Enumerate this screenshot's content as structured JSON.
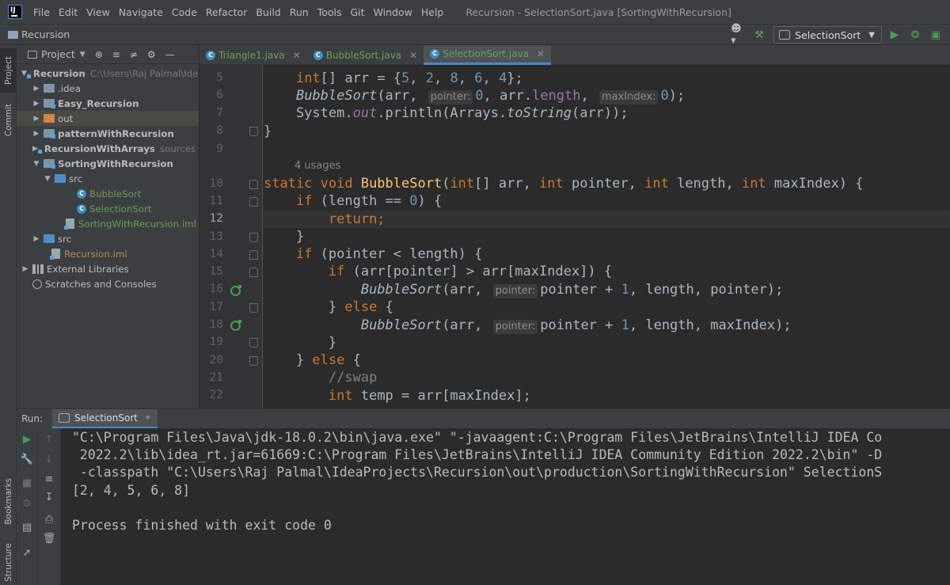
{
  "app": {
    "logo_text": "IJ",
    "window_title": "Recursion - SelectionSort.java [SortingWithRecursion]"
  },
  "menu": [
    "File",
    "Edit",
    "View",
    "Navigate",
    "Code",
    "Refactor",
    "Build",
    "Run",
    "Tools",
    "Git",
    "Window",
    "Help"
  ],
  "navbar": {
    "breadcrumb": "Recursion",
    "run_config": "SelectionSort"
  },
  "left_strip": {
    "project_tab": "Project",
    "commit_tab": "Commit",
    "bookmarks_tab": "Bookmarks",
    "structure_tab": "Structure"
  },
  "project_panel": {
    "title": "Project",
    "tree": [
      {
        "label": "Recursion",
        "hint": "C:\\Users\\Raj Palmal\\IdeaPr"
      },
      {
        "label": ".idea"
      },
      {
        "label": "Easy_Recursion"
      },
      {
        "label": "out"
      },
      {
        "label": "patternWithRecursion"
      },
      {
        "label": "RecursionWithArrays",
        "hint": "sources ro"
      },
      {
        "label": "SortingWithRecursion"
      },
      {
        "label": "src"
      },
      {
        "label": "BubbleSort"
      },
      {
        "label": "SelectionSort"
      },
      {
        "label": "SortingWithRecursion.iml"
      },
      {
        "label": "src"
      },
      {
        "label": "Recursion.iml"
      },
      {
        "label": "External Libraries"
      },
      {
        "label": "Scratches and Consoles"
      }
    ]
  },
  "tabs": [
    {
      "label": "Triangle1.java"
    },
    {
      "label": "BubbleSort.java"
    },
    {
      "label": "SelectionSort.java"
    }
  ],
  "editor": {
    "line_numbers": [
      "5",
      "6",
      "7",
      "8",
      "9",
      "10",
      "11",
      "12",
      "13",
      "14",
      "15",
      "16",
      "17",
      "18",
      "19",
      "20",
      "21",
      "22"
    ],
    "usages_hint": "4 usages",
    "hint_pointer": "pointer:",
    "hint_maxIndex": "maxIndex:"
  },
  "run_panel": {
    "label": "Run:",
    "tab": "SelectionSort",
    "console": [
      "\"C:\\Program Files\\Java\\jdk-18.0.2\\bin\\java.exe\" \"-javaagent:C:\\Program Files\\JetBrains\\IntelliJ IDEA Co",
      " 2022.2\\lib\\idea_rt.jar=61669:C:\\Program Files\\JetBrains\\IntelliJ IDEA Community Edition 2022.2\\bin\" -D",
      " -classpath \"C:\\Users\\Raj Palmal\\IdeaProjects\\Recursion\\out\\production\\SortingWithRecursion\" SelectionS",
      "[2, 4, 5, 6, 8]",
      "",
      "Process finished with exit code 0"
    ]
  }
}
